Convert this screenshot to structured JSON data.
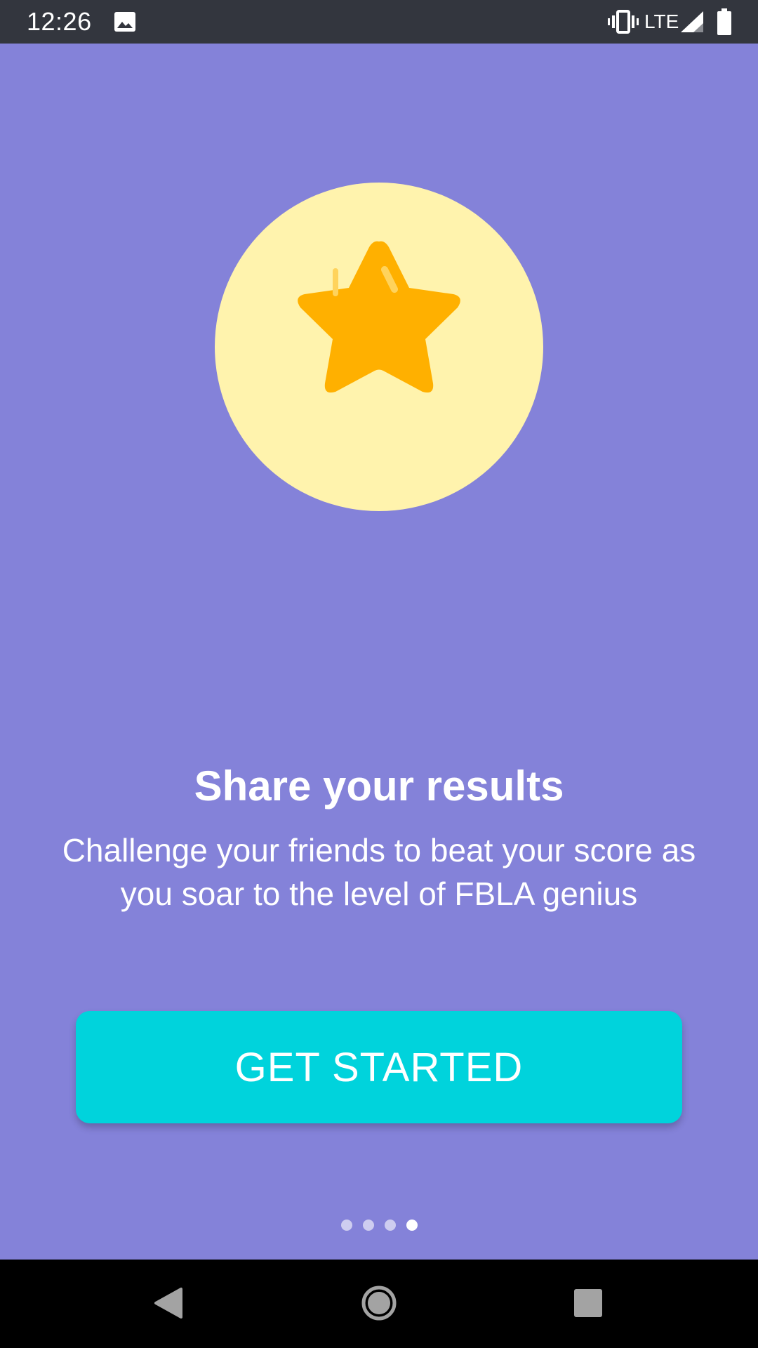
{
  "status_bar": {
    "time": "12:26",
    "network": "LTE",
    "icons": [
      "image-icon",
      "vibrate-icon",
      "signal-icon",
      "battery-icon"
    ]
  },
  "illustration": {
    "icon": "star-icon",
    "circle_color": "#fff3ad",
    "star_color": "#ffb000"
  },
  "slide": {
    "title": "Share your results",
    "description_line1": "Challenge your friends to beat your score as",
    "description_line2": "you soar to the level of FBLA genius"
  },
  "cta": {
    "label": "GET STARTED",
    "color": "#00d3dc"
  },
  "pager": {
    "total_pages": 4,
    "current_page": 4
  },
  "nav_bar": {
    "icons": [
      "back-icon",
      "home-icon",
      "recents-icon"
    ]
  },
  "colors": {
    "background": "#8482d9",
    "status_bar": "#33363e"
  }
}
